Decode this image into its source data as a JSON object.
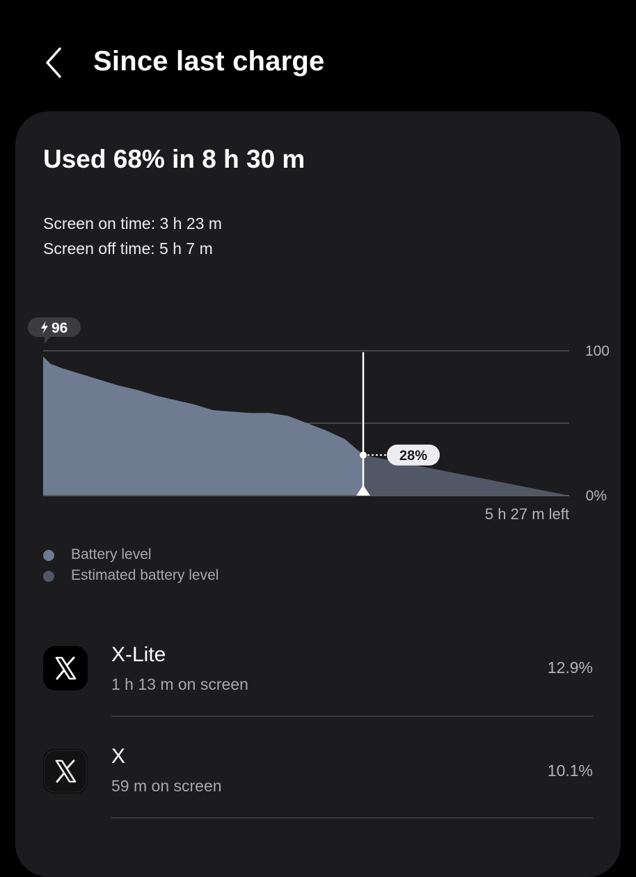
{
  "header": {
    "title": "Since last charge"
  },
  "summary": {
    "used_title": "Used 68% in 8 h 30 m",
    "screen_on": "Screen on time: 3 h 23 m",
    "screen_off": "Screen off time: 5 h 7 m"
  },
  "chart": {
    "start_badge": "96",
    "axis_top_label": "100",
    "axis_bottom_label": "0%",
    "current_label": "28%",
    "time_left": "5 h 27 m left"
  },
  "chart_data": {
    "type": "area",
    "ylim": [
      0,
      100
    ],
    "yticks": [
      "100",
      "0%"
    ],
    "grid": true,
    "start_value": 96,
    "current_value": 28,
    "time_left": "5 h 27 m left",
    "series": [
      {
        "name": "Battery level",
        "color": "#6f7b91",
        "x": [
          0.0,
          0.2,
          0.5,
          1.0,
          1.5,
          2.0,
          2.5,
          3.0,
          3.5,
          4.0,
          4.5,
          5.0,
          5.5,
          6.0,
          6.5,
          7.0,
          7.5,
          8.0,
          8.5
        ],
        "y": [
          96,
          91,
          88,
          84,
          80,
          76,
          73,
          69,
          66,
          63,
          59,
          58,
          57,
          57,
          55,
          50,
          45,
          39,
          28
        ]
      },
      {
        "name": "Estimated battery level",
        "color": "#515765",
        "x": [
          8.5,
          13.95
        ],
        "y": [
          28,
          0
        ]
      }
    ]
  },
  "legend": {
    "items": [
      {
        "label": "Battery level",
        "color": "#6f7b91"
      },
      {
        "label": "Estimated battery level",
        "color": "#515765"
      }
    ]
  },
  "apps": [
    {
      "name": "X-Lite",
      "sub": "1 h 13 m on screen",
      "percent": "12.9%",
      "icon": "x-logo-icon"
    },
    {
      "name": "X",
      "sub": "59 m on screen",
      "percent": "10.1%",
      "icon": "x-logo-icon"
    }
  ]
}
